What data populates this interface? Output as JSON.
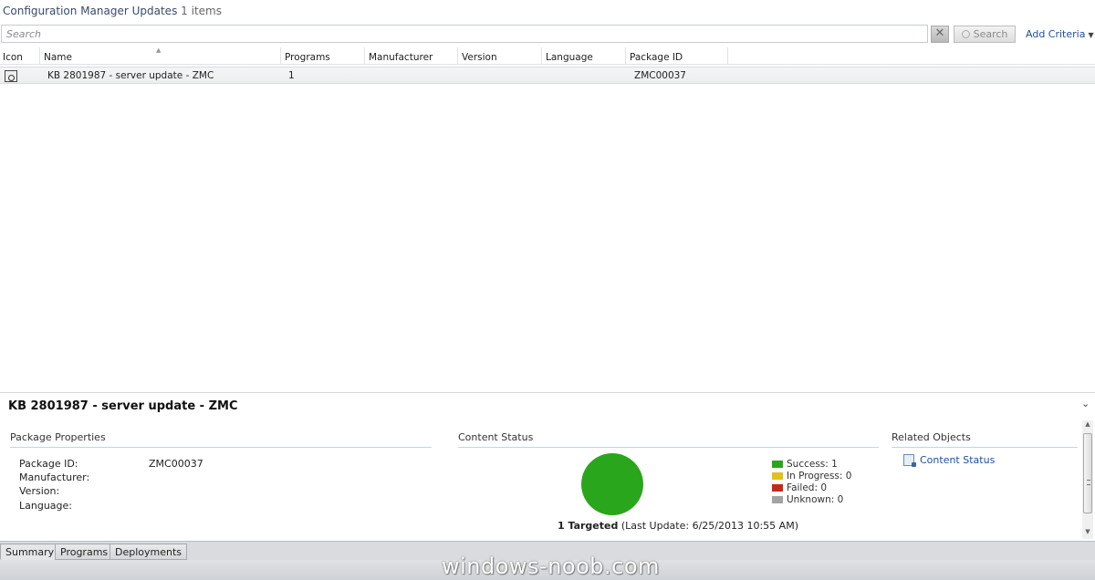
{
  "titlebar": {
    "title": "Configuration Manager Updates",
    "count": "1 items"
  },
  "search": {
    "placeholder": "Search",
    "value": "",
    "search_label": "Search",
    "add_criteria_label": "Add Criteria"
  },
  "grid": {
    "columns": [
      "Icon",
      "Name",
      "Programs",
      "Manufacturer",
      "Version",
      "Language",
      "Package ID"
    ],
    "rows": [
      {
        "icon": "package-icon",
        "name": "KB 2801987 - server update - ZMC",
        "programs": "1",
        "manufacturer": "",
        "version": "",
        "language": "",
        "package_id": "ZMC00037"
      }
    ]
  },
  "details": {
    "title": "KB 2801987 - server update - ZMC",
    "package_properties": {
      "header": "Package Properties",
      "labels": {
        "package_id": "Package ID:",
        "manufacturer": "Manufacturer:",
        "version": "Version:",
        "language": "Language:"
      },
      "values": {
        "package_id": "ZMC00037",
        "manufacturer": "",
        "version": "",
        "language": ""
      }
    },
    "content_status": {
      "header": "Content Status",
      "legend": [
        {
          "label": "Success: 1",
          "color": "#2aa61c"
        },
        {
          "label": "In Progress: 0",
          "color": "#e0c21a"
        },
        {
          "label": "Failed: 0",
          "color": "#c42a1a"
        },
        {
          "label": "Unknown: 0",
          "color": "#a3a3a3"
        }
      ],
      "pie_color": "#2aa61c",
      "targeted_bold": "1 Targeted",
      "last_update": "(Last Update: 6/25/2013 10:55 AM)"
    },
    "related_objects": {
      "header": "Related Objects",
      "link_label": "Content Status"
    }
  },
  "tabs": [
    "Summary",
    "Programs",
    "Deployments"
  ],
  "watermark": "windows-noob.com"
}
